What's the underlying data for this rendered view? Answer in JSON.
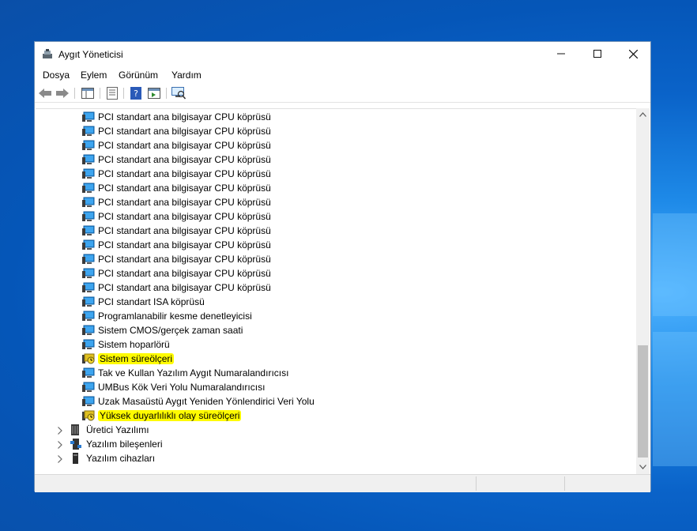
{
  "window": {
    "title": "Aygıt Yöneticisi"
  },
  "menu": [
    "Dosya",
    "Eylem",
    "Görünüm",
    "Yardım"
  ],
  "toolbar_icons": [
    "back-arrow-icon",
    "forward-arrow-icon",
    "properties-pane-icon",
    "device-list-icon",
    "help-icon",
    "run-icon",
    "scan-hardware-icon"
  ],
  "devices": [
    "PCI standart ana bilgisayar CPU köprüsü",
    "PCI standart ana bilgisayar CPU köprüsü",
    "PCI standart ana bilgisayar CPU köprüsü",
    "PCI standart ana bilgisayar CPU köprüsü",
    "PCI standart ana bilgisayar CPU köprüsü",
    "PCI standart ana bilgisayar CPU köprüsü",
    "PCI standart ana bilgisayar CPU köprüsü",
    "PCI standart ana bilgisayar CPU köprüsü",
    "PCI standart ana bilgisayar CPU köprüsü",
    "PCI standart ana bilgisayar CPU köprüsü",
    "PCI standart ana bilgisayar CPU köprüsü",
    "PCI standart ana bilgisayar CPU köprüsü",
    "PCI standart ana bilgisayar CPU köprüsü",
    "PCI standart ISA köprüsü",
    "Programlanabilir kesme denetleyicisi",
    "Sistem CMOS/gerçek zaman saati",
    "Sistem hoparlörü",
    "Sistem süreölçeri",
    "Tak ve Kullan Yazılım Aygıt Numaralandırıcısı",
    "UMBus Kök Veri Yolu Numaralandırıcısı",
    "Uzak Masaüstü Aygıt Yeniden Yönlendirici Veri Yolu",
    "Yüksek duyarlılıklı olay süreölçeri"
  ],
  "highlighted": [
    "Sistem süreölçeri",
    "Yüksek duyarlılıklı olay süreölçeri"
  ],
  "categories": [
    {
      "label": "Üretici Yazılımı",
      "icon": "firmware-icon"
    },
    {
      "label": "Yazılım bileşenleri",
      "icon": "software-components-icon"
    },
    {
      "label": "Yazılım cihazları",
      "icon": "software-devices-icon"
    }
  ],
  "colors": {
    "highlight": "#fffb00",
    "desktop": "#0a63c9"
  }
}
